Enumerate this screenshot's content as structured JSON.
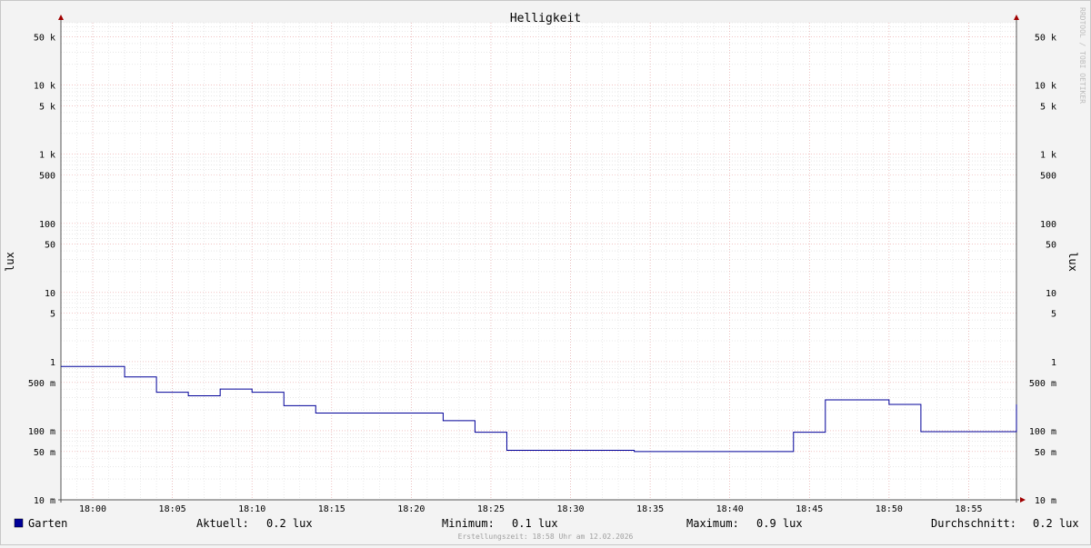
{
  "chart_data": {
    "type": "line",
    "title": "Helligkeit",
    "ylabel": "lux",
    "ylabel_right": "lux",
    "y_scale": "log",
    "ylim": [
      0.01,
      80000
    ],
    "y_ticks": [
      {
        "value": 50000,
        "label": "50 k"
      },
      {
        "value": 10000,
        "label": "10 k"
      },
      {
        "value": 5000,
        "label": "5 k"
      },
      {
        "value": 1000,
        "label": "1 k"
      },
      {
        "value": 500,
        "label": "500"
      },
      {
        "value": 100,
        "label": "100"
      },
      {
        "value": 50,
        "label": "50"
      },
      {
        "value": 10,
        "label": "10"
      },
      {
        "value": 5,
        "label": "5"
      },
      {
        "value": 1,
        "label": "1"
      },
      {
        "value": 0.5,
        "label": "500 m"
      },
      {
        "value": 0.1,
        "label": "100 m"
      },
      {
        "value": 0.05,
        "label": "50 m"
      },
      {
        "value": 0.01,
        "label": "10 m"
      }
    ],
    "xlim": [
      "17:58",
      "17:58 +60"
    ],
    "x_ticks": [
      "18:00",
      "18:05",
      "18:10",
      "18:15",
      "18:20",
      "18:25",
      "18:30",
      "18:35",
      "18:40",
      "18:45",
      "18:50",
      "18:55"
    ],
    "grid": true,
    "series": [
      {
        "name": "Garten",
        "color": "#000099",
        "x": [
          "17:58",
          "18:02",
          "18:04",
          "18:06",
          "18:08",
          "18:10",
          "18:12",
          "18:14",
          "18:20",
          "18:22",
          "18:24",
          "18:26",
          "18:34",
          "18:44",
          "18:46",
          "18:50",
          "18:52",
          "18:58"
        ],
        "values": [
          0.85,
          0.6,
          0.36,
          0.32,
          0.4,
          0.36,
          0.23,
          0.18,
          0.18,
          0.14,
          0.095,
          0.052,
          0.05,
          0.095,
          0.28,
          0.24,
          0.097,
          0.24
        ]
      }
    ],
    "legend": {
      "position": "bottom",
      "stats": [
        {
          "label": "Aktuell:",
          "value": "0.2 lux"
        },
        {
          "label": "Minimum:",
          "value": "0.1 lux"
        },
        {
          "label": "Maximum:",
          "value": "0.9 lux"
        },
        {
          "label": "Durchschnitt:",
          "value": "0.2 lux"
        }
      ]
    },
    "footer": "Erstellungszeit: 18:58 Uhr am 12.02.2026",
    "watermark": "RRDTOOL / TOBI OETIKER"
  }
}
